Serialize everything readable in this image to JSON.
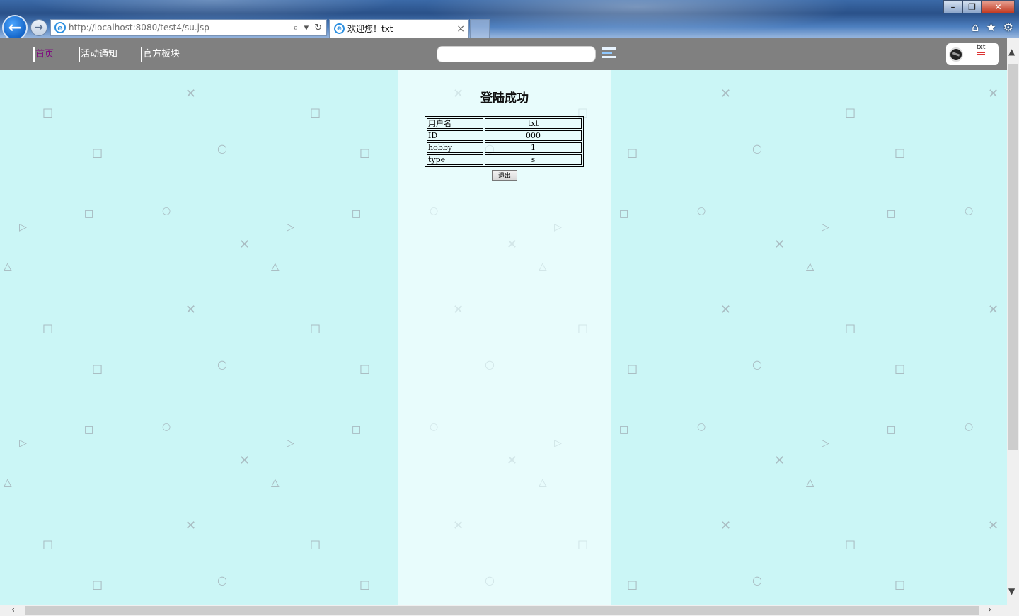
{
  "browser": {
    "url": "http://localhost:8080/test4/su.jsp",
    "tab_title": "欢迎您！txt",
    "tab_close": "×",
    "window": {
      "minimize": "–",
      "restore": "❐",
      "close": "✕"
    },
    "icons": [
      "back-arrow-icon",
      "forward-arrow-icon",
      "ie-logo-icon",
      "search-icon",
      "refresh-icon",
      "home-icon",
      "favorites-star-icon",
      "settings-gear-icon"
    ]
  },
  "nav": {
    "items": [
      {
        "label": "首页",
        "active": true
      },
      {
        "label": "活动通知",
        "active": false
      },
      {
        "label": "官方板块",
        "active": false
      }
    ],
    "search_value": "",
    "user": {
      "name": "txt"
    }
  },
  "main": {
    "title": "登陆成功",
    "rows": [
      {
        "key": "用户名",
        "value": "txt"
      },
      {
        "key": "ID",
        "value": "000"
      },
      {
        "key": "hobby",
        "value": "1"
      },
      {
        "key": "type",
        "value": "s"
      }
    ],
    "logout_label": "退出"
  },
  "colors": {
    "page_bg": "#cbf6f6",
    "center_bg": "#e8fcfc",
    "nav_bg": "#808080",
    "active_nav": "#800080"
  }
}
